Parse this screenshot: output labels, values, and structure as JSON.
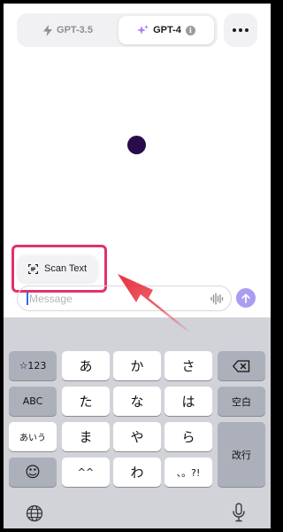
{
  "model_switcher": {
    "gpt35_label": "GPT-3.5",
    "gpt4_label": "GPT-4",
    "gpt4_info_glyph": "i",
    "selected": "GPT-4"
  },
  "more_menu": {
    "icon": "more-horizontal-icon"
  },
  "popup": {
    "scan_text_label": "Scan Text",
    "icon": "scan-text-icon"
  },
  "composer": {
    "placeholder": "Message",
    "voice_icon": "waveform-icon",
    "send_icon": "arrow-up-icon"
  },
  "keyboard": {
    "row1": {
      "mode": "☆123",
      "keys": [
        "あ",
        "か",
        "さ"
      ],
      "delete_icon": "delete-left-icon"
    },
    "row2": {
      "mode": "ABC",
      "keys": [
        "た",
        "な",
        "は"
      ],
      "space": "空白"
    },
    "row3": {
      "mode": "あいう",
      "keys": [
        "ま",
        "や",
        "ら"
      ],
      "return": "改行"
    },
    "row4": {
      "emoji_glyph": "☺",
      "keys": [
        "^^",
        "わ",
        "、。?!"
      ]
    },
    "globe_icon": "globe-icon",
    "mic_icon": "microphone-icon"
  },
  "colors": {
    "accent_purple": "#a99cf2",
    "highlight_pink": "#e0336a",
    "arrow_red": "#e8303d",
    "keyboard_bg": "#d1d3d9"
  }
}
